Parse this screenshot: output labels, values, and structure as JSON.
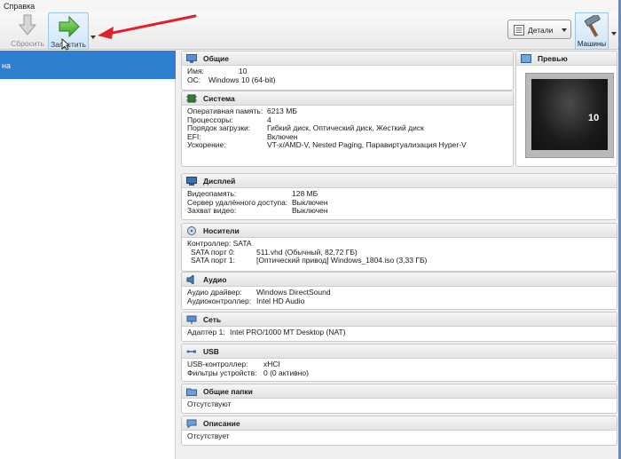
{
  "menu": {
    "help": "Справка"
  },
  "toolbar": {
    "reset_label": "Сбросить",
    "start_label": "Запустить",
    "details_label": "Детали",
    "machines_label": "Машины"
  },
  "vm_list": {
    "selected_name": "на"
  },
  "sections": {
    "general": {
      "title": "Общие",
      "rows": [
        {
          "k": "Имя:",
          "v": "10"
        },
        {
          "k": "ОС:",
          "v": "Windows 10 (64-bit)"
        }
      ]
    },
    "preview": {
      "title": "Превью",
      "screen_text": "10"
    },
    "system": {
      "title": "Система",
      "rows": [
        {
          "k": "Оперативная память:",
          "v": "6213 МБ"
        },
        {
          "k": "Процессоры:",
          "v": "4"
        },
        {
          "k": "Порядок загрузки:",
          "v": "Гибкий диск, Оптический диск, Жесткий диск"
        },
        {
          "k": "EFI:",
          "v": "Включен"
        },
        {
          "k": "Ускорение:",
          "v": "VT-x/AMD-V, Nested Paging, Паравиртуализация Hyper-V"
        }
      ]
    },
    "display": {
      "title": "Дисплей",
      "rows": [
        {
          "k": "Видеопамять:",
          "v": "128 МБ"
        },
        {
          "k": "Сервер удалённого доступа:",
          "v": "Выключен"
        },
        {
          "k": "Захват видео:",
          "v": "Выключен"
        }
      ]
    },
    "storage": {
      "title": "Носители",
      "controller": "Контроллер: SATA",
      "rows": [
        {
          "k": "SATA порт 0:",
          "v": "511.vhd (Обычный, 82,72 ГБ)"
        },
        {
          "k": "SATA порт 1:",
          "v": "[Оптический привод] Windows_1804.iso (3,33 ГБ)"
        }
      ]
    },
    "audio": {
      "title": "Аудио",
      "rows": [
        {
          "k": "Аудио драйвер:",
          "v": "Windows DirectSound"
        },
        {
          "k": "Аудиоконтроллер:",
          "v": "Intel HD Audio"
        }
      ]
    },
    "network": {
      "title": "Сеть",
      "rows": [
        {
          "k": "Адаптер 1:",
          "v": "Intel PRO/1000 MT Desktop (NAT)"
        }
      ]
    },
    "usb": {
      "title": "USB",
      "rows": [
        {
          "k": "USB-контроллер:",
          "v": "xHCI"
        },
        {
          "k": "Фильтры устройств:",
          "v": "0 (0 активно)"
        }
      ]
    },
    "shared": {
      "title": "Общие папки",
      "text": "Отсутствуют"
    },
    "description": {
      "title": "Описание",
      "text": "Отсутствует"
    }
  },
  "colors": {
    "selection": "#2f7fd1",
    "annotation_arrow": "#e0202a"
  }
}
